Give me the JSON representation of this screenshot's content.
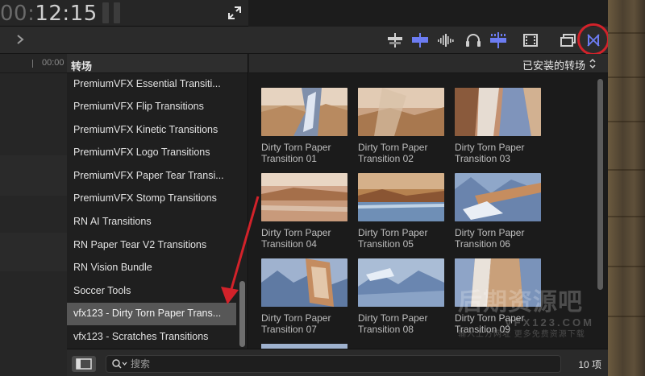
{
  "viewer": {
    "timecode_dim": "00:",
    "timecode_main": "12:15",
    "timeline_ruler": "00:00"
  },
  "sidebar": {
    "title": "转场",
    "items": [
      {
        "label": "PremiumVFX Essential Transiti..."
      },
      {
        "label": "PremiumVFX Flip Transitions"
      },
      {
        "label": "PremiumVFX Kinetic Transitions"
      },
      {
        "label": "PremiumVFX Logo Transitions"
      },
      {
        "label": "PremiumVFX Paper Tear Transi..."
      },
      {
        "label": "PremiumVFX Stomp Transitions"
      },
      {
        "label": "RN AI Transitions"
      },
      {
        "label": "RN Paper Tear V2 Transitions"
      },
      {
        "label": "RN Vision Bundle"
      },
      {
        "label": "Soccer Tools"
      },
      {
        "label": "vfx123 - Dirty Torn Paper Trans...",
        "selected": true
      },
      {
        "label": "vfx123 - Scratches Transitions"
      }
    ]
  },
  "browser": {
    "title": "已安装的转场",
    "tiles": [
      {
        "line1": "Dirty Torn Paper",
        "line2": "Transition 01"
      },
      {
        "line1": "Dirty Torn Paper",
        "line2": "Transition 02"
      },
      {
        "line1": "Dirty Torn Paper",
        "line2": "Transition 03"
      },
      {
        "line1": "Dirty Torn Paper",
        "line2": "Transition 04"
      },
      {
        "line1": "Dirty Torn Paper",
        "line2": "Transition 05"
      },
      {
        "line1": "Dirty Torn Paper",
        "line2": "Transition 06"
      },
      {
        "line1": "Dirty Torn Paper",
        "line2": "Transition 07"
      },
      {
        "line1": "Dirty Torn Paper",
        "line2": "Transition 08"
      },
      {
        "line1": "Dirty Torn Paper",
        "line2": "Transition 09"
      }
    ]
  },
  "bottombar": {
    "search_placeholder": "搜索",
    "count": "10 项"
  },
  "watermark": {
    "main": "后期资源吧",
    "sub": "VFX123.COM",
    "small": "输入上方网址 更多免费资源下载"
  },
  "toolbar": {
    "icons": [
      "skimming-icon",
      "snapping-icon",
      "audio-skimming-icon",
      "headphones-icon",
      "solo-icon",
      "clip-appearance-icon",
      "browser-window-icon",
      "transitions-browser-icon"
    ]
  },
  "colors": {
    "accent_blue": "#6c7cf2",
    "selection_gray": "#575757",
    "annotation_red": "#d2222a"
  }
}
